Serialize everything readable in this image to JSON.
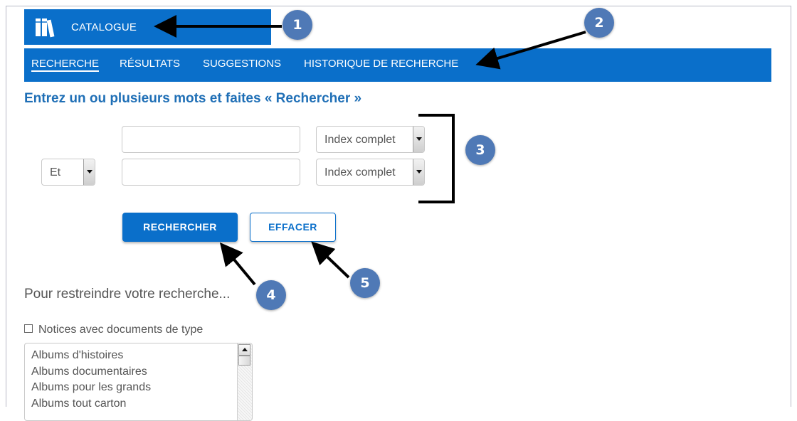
{
  "header": {
    "brand_label": "CATALOGUE",
    "brand_icon": "books-icon"
  },
  "nav": {
    "items": [
      {
        "label": "RECHERCHE",
        "active": true
      },
      {
        "label": "RÉSULTATS",
        "active": false
      },
      {
        "label": "SUGGESTIONS",
        "active": false
      },
      {
        "label": "HISTORIQUE DE RECHERCHE",
        "active": false
      }
    ]
  },
  "search": {
    "heading": "Entrez un ou plusieurs mots et faites « Rechercher »",
    "rows": [
      {
        "operator": null,
        "term": "",
        "index": "Index complet"
      },
      {
        "operator": "Et",
        "term": "",
        "index": "Index complet"
      }
    ],
    "submit_label": "RECHERCHER",
    "clear_label": "EFFACER"
  },
  "filters": {
    "restrict_label": "Pour restreindre votre recherche...",
    "doc_type_checkbox_label": "Notices avec documents de type",
    "doc_types": [
      "Albums d'histoires",
      "Albums documentaires",
      "Albums pour les grands",
      "Albums tout carton"
    ]
  },
  "annotations": {
    "callouts": [
      "1",
      "2",
      "3",
      "4",
      "5"
    ]
  },
  "colors": {
    "primary": "#0a6fca",
    "heading": "#1f6fb6",
    "callout": "#4f79b6"
  }
}
